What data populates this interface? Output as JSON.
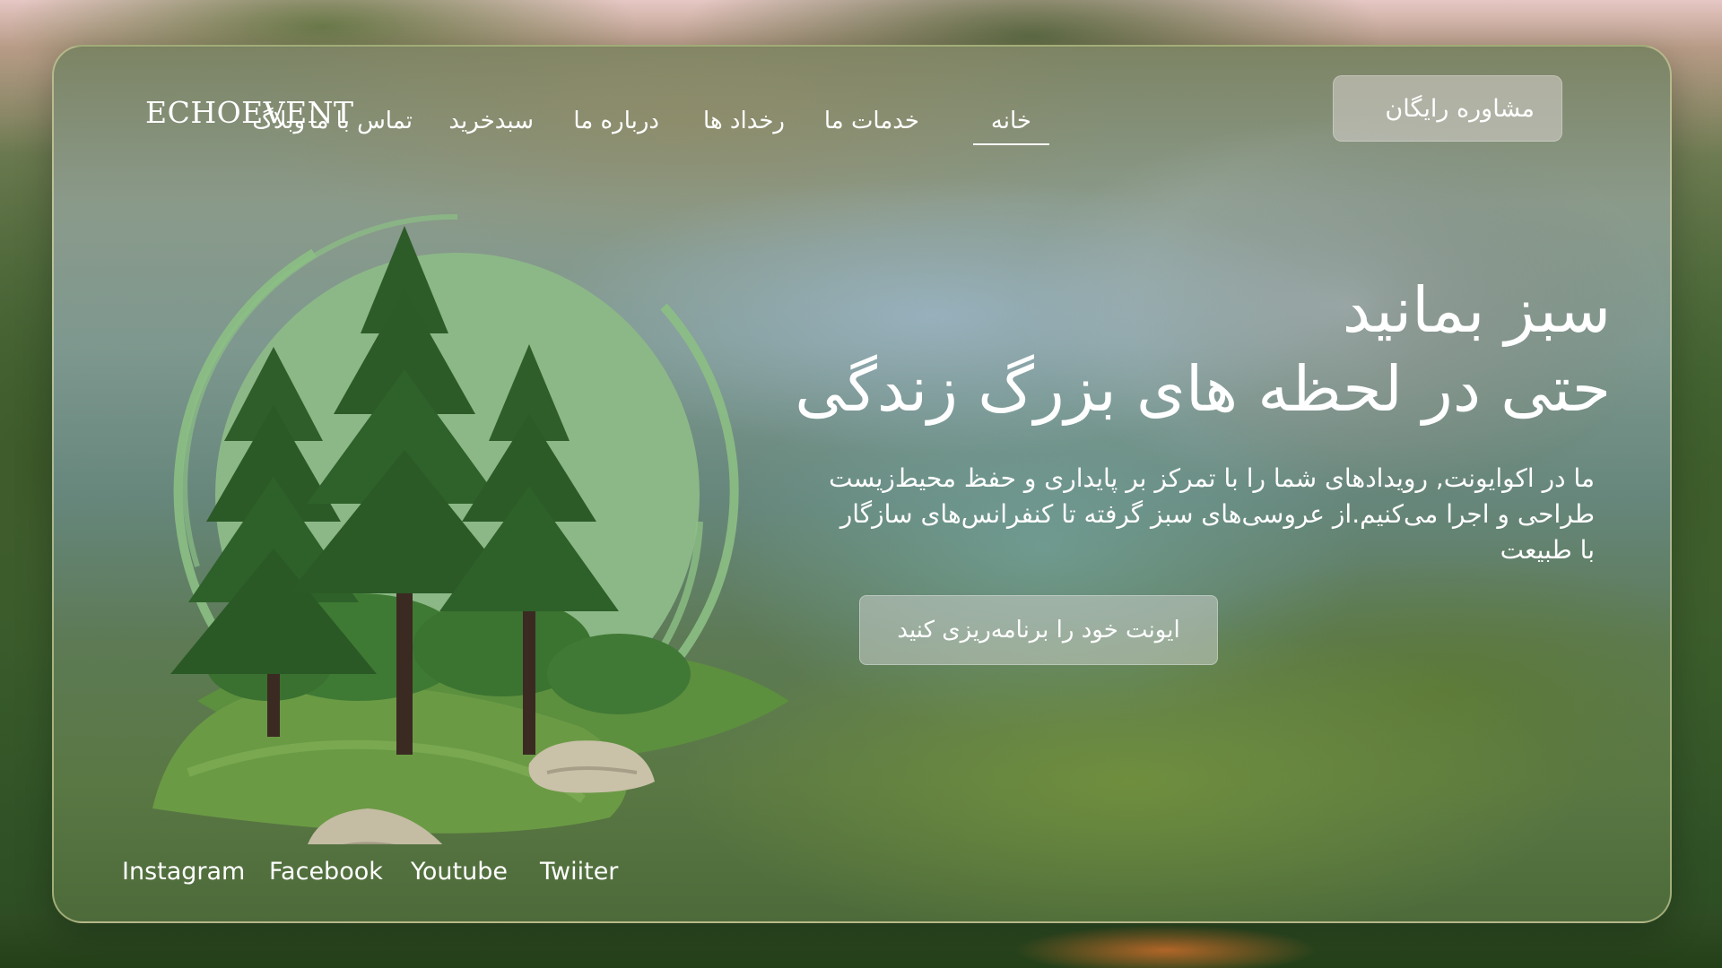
{
  "brand": {
    "logo": "ECHOEVENT"
  },
  "nav": {
    "items": [
      {
        "label": "خانه",
        "active": true
      },
      {
        "label": "خدمات ما",
        "active": false
      },
      {
        "label": "رخداد ها",
        "active": false
      },
      {
        "label": "درباره ما",
        "active": false
      },
      {
        "label": "سبدخرید",
        "active": false
      },
      {
        "label": "تماس با ما",
        "active": false
      },
      {
        "label": "وبلاگ",
        "active": false
      }
    ],
    "consult_button": "مشاوره رایگان"
  },
  "hero": {
    "title_line1": "سبز بمانید",
    "title_line2": "حتی در لحظه های بزرگ زندگی",
    "description": "ما در اکوایونت, رویدادهای شما را با تمرکز بر پایداری و حفظ محیط‌زیست طراحی و اجرا می‌کنیم.از عروسی‌های سبز گرفته تا کنفرانس‌های سازگار با طبیعت",
    "cta_button": "ایونت خود را برنامه‌ریزی کنید"
  },
  "social": {
    "links": [
      "Instagram",
      "Facebook",
      "Youtube",
      "Twiiter"
    ]
  },
  "colors": {
    "accent_green": "#8cb887",
    "text": "#ffffff",
    "glass_button": "#d7d2cd"
  }
}
